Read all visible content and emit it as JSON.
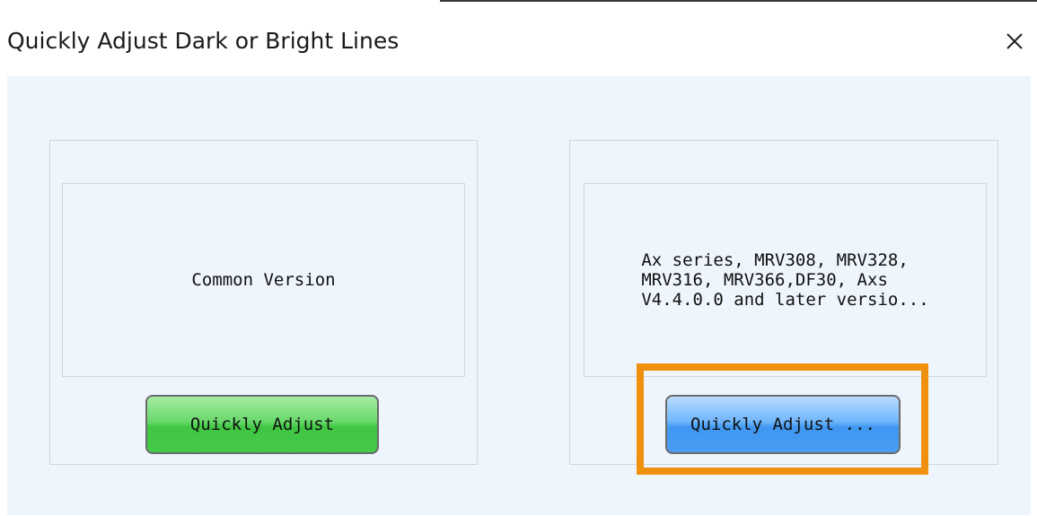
{
  "dialog": {
    "title": "Quickly Adjust Dark or Bright Lines",
    "close_icon": "close-icon"
  },
  "options": [
    {
      "description": "Common Version",
      "button_label": "Quickly Adjust",
      "button_color": "#45c94a"
    },
    {
      "description": "Ax series, MRV308, MRV328,\nMRV316, MRV366,DF30, Axs\nV4.4.0.0 and later versio...",
      "button_label": "Quickly Adjust ...",
      "button_color": "#4a9df3",
      "highlighted": true
    }
  ],
  "colors": {
    "client_background": "#eef5fd",
    "highlight": "#f0900f"
  }
}
